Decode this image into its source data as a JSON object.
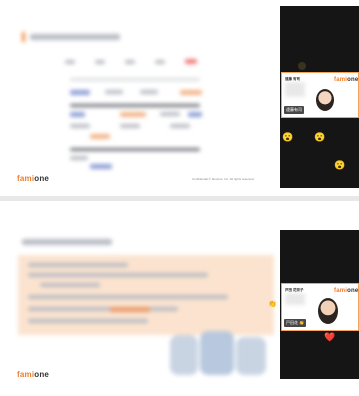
{
  "logo": {
    "brand_a": "fami",
    "brand_b": "one"
  },
  "frame1": {
    "footer": "Confidential   © famione, Inc. All rights reserved.",
    "card": {
      "logo_a": "fami",
      "logo_b": "one",
      "name_label": "遠藤 有司",
      "name_tag": "遠藤有司"
    },
    "emojis": [
      "😮",
      "😮",
      "😮"
    ]
  },
  "frame2": {
    "card": {
      "logo_a": "fami",
      "logo_b": "one",
      "name_label": "戸田 花奈子",
      "name_tag": "戸田花"
    },
    "emojis": [
      "👏",
      "❤️",
      "👏"
    ]
  },
  "colors": {
    "brand_orange": "#f07d2a",
    "panel_bg": "#151515",
    "peach": "#fbe3cf"
  }
}
